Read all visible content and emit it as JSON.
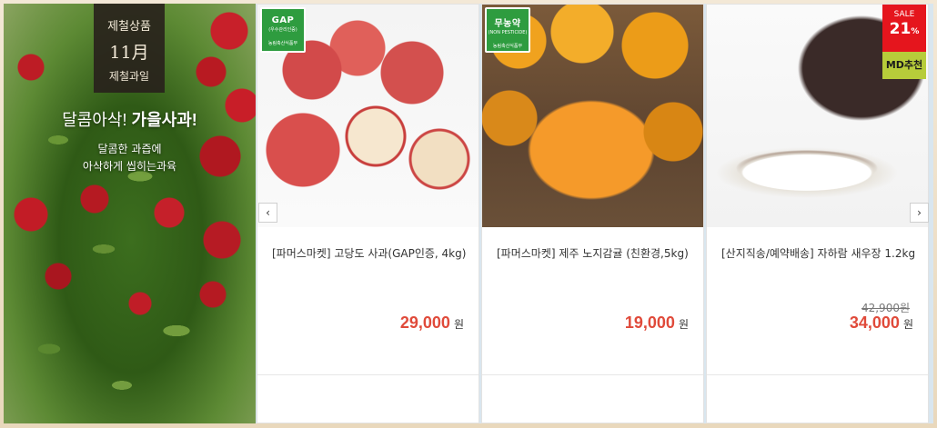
{
  "banner": {
    "tag_line1": "제철상품",
    "tag_line2": "11月",
    "tag_line3": "제철과일",
    "title_light": "달콤아삭!",
    "title_bold": "가을사과!",
    "sub_line1": "달콤한 과즙에",
    "sub_line2": "아삭하게 씹히는과육"
  },
  "products": [
    {
      "name": "[파머스마켓] 고당도 사과(GAP인증, 4kg)",
      "price": "29,000",
      "unit": "원",
      "badge": {
        "title": "GAP",
        "sub": "(우수관리인증)",
        "org": "농림축산식품부"
      }
    },
    {
      "name": "[파머스마켓] 제주 노지감귤 (친환경,5kg)",
      "price": "19,000",
      "unit": "원",
      "badge": {
        "title": "무농약",
        "sub": "(NON PESTICIDE)",
        "org": "농림축산식품부"
      }
    },
    {
      "name": "[산지직송/예약배송] 자하람 새우장 1.2kg",
      "orig_price": "42,900원",
      "price": "34,000",
      "unit": "원",
      "sale": {
        "label": "SALE",
        "value": "21",
        "pct": "%"
      },
      "md_label": "MD추천"
    }
  ],
  "nav": {
    "prev": "‹",
    "next": "›"
  },
  "colors": {
    "price": "#e04a3a",
    "cert_green": "#2e9c3f",
    "sale_red": "#e5151d",
    "md_green": "#b7cc3a"
  }
}
